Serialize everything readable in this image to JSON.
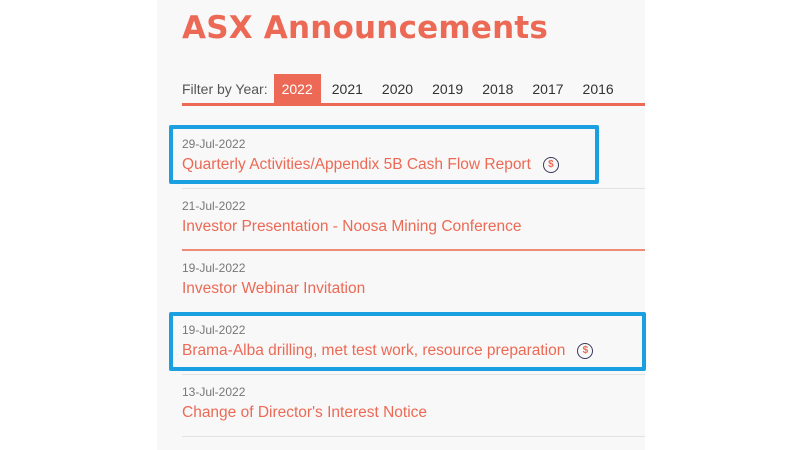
{
  "page": {
    "title": "ASX Announcements"
  },
  "filter": {
    "label": "Filter by Year:",
    "years": [
      "2022",
      "2021",
      "2020",
      "2019",
      "2018",
      "2017",
      "2016"
    ],
    "selected": "2022"
  },
  "announcements": [
    {
      "date": "29-Jul-2022",
      "title": "Quarterly Activities/Appendix 5B Cash Flow Report",
      "price_sensitive": true,
      "highlighted": true
    },
    {
      "date": "21-Jul-2022",
      "title": "Investor Presentation - Noosa Mining Conference",
      "price_sensitive": false,
      "highlighted": false
    },
    {
      "date": "19-Jul-2022",
      "title": "Investor Webinar Invitation",
      "price_sensitive": false,
      "highlighted": false
    },
    {
      "date": "19-Jul-2022",
      "title": "Brama-Alba drilling, met test work, resource preparation",
      "price_sensitive": true,
      "highlighted": true
    },
    {
      "date": "13-Jul-2022",
      "title": "Change of Director's Interest Notice",
      "price_sensitive": false,
      "highlighted": false
    }
  ],
  "icons": {
    "price_sensitive": "dollar-circle-icon",
    "price_sensitive_glyph": "$"
  },
  "colors": {
    "accent": "#ec6a55",
    "highlight": "#1a9fe0"
  }
}
